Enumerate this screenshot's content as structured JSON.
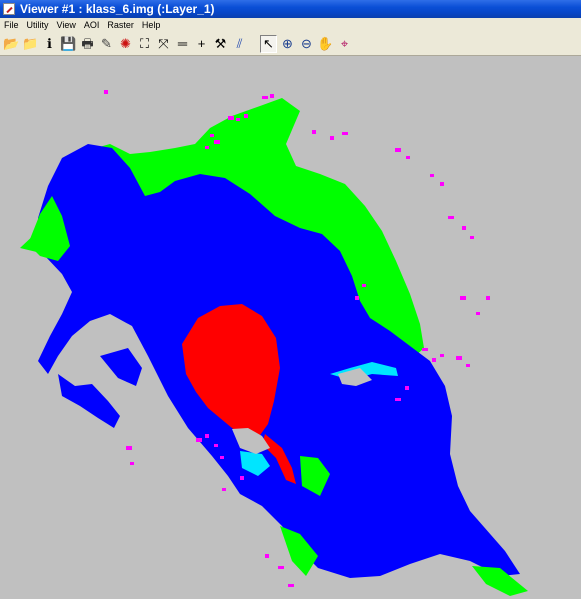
{
  "window": {
    "title": "Viewer #1 : klass_6.img (:Layer_1)"
  },
  "menu": {
    "items": [
      "File",
      "Utility",
      "View",
      "AOI",
      "Raster",
      "Help"
    ]
  },
  "toolbar": {
    "tools": [
      {
        "name": "open-folder-icon",
        "glyph": "📂",
        "color": "#d9a520"
      },
      {
        "name": "open-layer-icon",
        "glyph": "📁",
        "color": "#6b7b2a"
      },
      {
        "name": "info-icon",
        "glyph": "ℹ",
        "color": "#000000"
      },
      {
        "name": "save-icon",
        "glyph": "💾",
        "color": "#1a1a1a"
      },
      {
        "name": "print-icon",
        "glyph": "🖶",
        "color": "#333333"
      },
      {
        "name": "eraser-icon",
        "glyph": "✎",
        "color": "#444444"
      },
      {
        "name": "roam-icon",
        "glyph": "✺",
        "color": "#cc1111"
      },
      {
        "name": "fit-window-icon",
        "glyph": "⛶",
        "color": "#000000"
      },
      {
        "name": "scale-icon",
        "glyph": "⤧",
        "color": "#000000"
      },
      {
        "name": "measure-icon",
        "glyph": "═",
        "color": "#000000"
      },
      {
        "name": "crosshair-icon",
        "glyph": "+",
        "color": "#000000"
      },
      {
        "name": "hammer-icon",
        "glyph": "⚒",
        "color": "#000000"
      },
      {
        "name": "profile-icon",
        "glyph": "⫽",
        "color": "#2a4fb0"
      },
      {
        "name": "select-arrow-icon",
        "glyph": "↖",
        "color": "#000000",
        "pressed": true,
        "sep": true
      },
      {
        "name": "zoom-in-icon",
        "glyph": "⊕",
        "color": "#1a3e8f"
      },
      {
        "name": "zoom-out-icon",
        "glyph": "⊖",
        "color": "#1a3e8f"
      },
      {
        "name": "pan-hand-icon",
        "glyph": "✋",
        "color": "#000000"
      },
      {
        "name": "inquire-icon",
        "glyph": "⌖",
        "color": "#b01060"
      }
    ]
  },
  "map": {
    "background": "#c0c0c0",
    "class_colors": {
      "deep_water": "#0000ff",
      "shallow": "#00ff00",
      "red_zone": "#ff0000",
      "magenta": "#ff00ff",
      "cyan": "#00e5ff",
      "gray": "#c0c0c0"
    }
  }
}
